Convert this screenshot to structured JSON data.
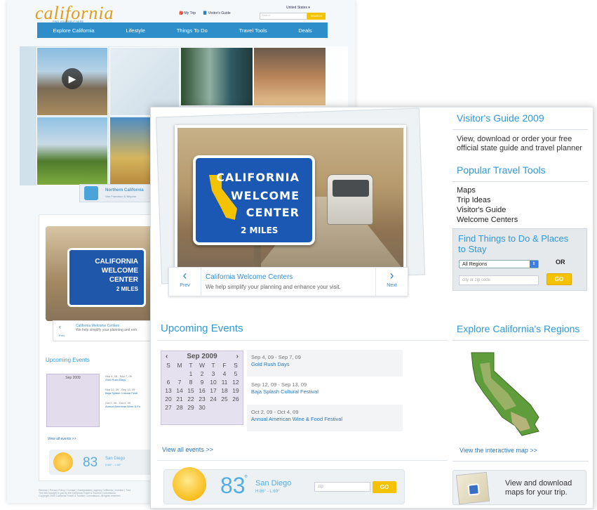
{
  "back_page": {
    "logo": "california",
    "tagline": "FIND YOURSELF HERE",
    "utility": {
      "my_trip": "My Trip",
      "visitors_guide": "Visitor's Guide",
      "country": "United States",
      "search_placeholder": "Search",
      "search_button": "SEARCH"
    },
    "nav": [
      "Explore California",
      "Lifestyle",
      "Things To Do",
      "Travel Tools",
      "Deals"
    ],
    "region_banner": {
      "title": "Northern California",
      "sub": "San Francisco & Beyond"
    },
    "feature": {
      "sign_lines": [
        "CALIFORNIA",
        "WELCOME",
        "CENTER",
        "2 MILES"
      ],
      "caption_title": "California Welcome Centers",
      "caption_sub": "We help simplify your planning and enh",
      "prev": "Prev"
    },
    "upcoming": "Upcoming Events",
    "calendar_title": "Sep 2009",
    "events": [
      {
        "date": "Sep 4, 09 - Sep 7, 09",
        "name": "Gold Rush Days"
      },
      {
        "date": "Sep 12, 09 - Sep 13, 09",
        "name": "Baja Splash Cultural Festi"
      },
      {
        "date": "Oct 2, 09 - Oct 4, 09",
        "name": "Annual American Wine & Fo"
      }
    ],
    "view_all": "View all events >>",
    "weather": {
      "temp": "83",
      "city": "San Diego",
      "hilo": "H:86° - L:69°"
    },
    "footer": "Sitemap | Privacy Policy | Contact | Sweepstakes | Agency Celifornia | Investor | Trad\nThis site brought to you by the California Travel & Tourism Commission.\nCopyright 2009 California Travel & Tourism Commission. All rights reserved."
  },
  "feature": {
    "sign_lines": [
      "CALIFORNIA",
      "WELCOME",
      "CENTER",
      "2 MILES"
    ],
    "caption_title": "California Welcome Centers",
    "caption_sub": "We help simplify your planning and enhance your visit.",
    "prev": "Prev",
    "next": "Next"
  },
  "guide": {
    "title": "Visitor's Guide 2009",
    "text": "View, download or order your free official state guide and travel planner"
  },
  "tools": {
    "title": "Popular Travel Tools",
    "links": [
      "Maps",
      "Trip Ideas",
      "Visitor's Guide",
      "Welcome Centers"
    ]
  },
  "find": {
    "title": "Find Things to Do & Places to Stay",
    "region": "All Regions",
    "or": "OR",
    "city_placeholder": "city or zip code",
    "go": "GO"
  },
  "events": {
    "title": "Upcoming Events",
    "calendar": {
      "month": "Sep 2009",
      "weekdays": [
        "S",
        "M",
        "T",
        "W",
        "T",
        "F",
        "S"
      ],
      "days": [
        "",
        "",
        "1",
        "2",
        "3",
        "4",
        "5",
        "6",
        "7",
        "8",
        "9",
        "10",
        "11",
        "12",
        "13",
        "14",
        "15",
        "16",
        "17",
        "18",
        "19",
        "20",
        "21",
        "22",
        "23",
        "24",
        "25",
        "26",
        "27",
        "28",
        "29",
        "30",
        "",
        "",
        ""
      ]
    },
    "list": [
      {
        "date": "Sep 4, 09 - Sep 7, 09",
        "name": "Gold Rush Days"
      },
      {
        "date": "Sep 12, 09 - Sep 13, 09",
        "name": "Baja Splash Cultural Festival"
      },
      {
        "date": "Oct 2, 09 - Oct 4, 09",
        "name": "Annual American Wine & Food Festival"
      }
    ],
    "view_all": "View all events >>"
  },
  "weather": {
    "temp": "83",
    "degree": "°",
    "city": "San Diego",
    "hilo": "H:86° - L:69°",
    "zip_placeholder": "zip",
    "go": "GO"
  },
  "regions": {
    "title": "Explore California's Regions",
    "map_link": "View the interactive map >>",
    "maps_promo": "View and download maps for your trip."
  },
  "colors": {
    "brand_blue": "#2d8ec9",
    "accent_yellow": "#f5c200",
    "sign_blue": "#1a58b4"
  }
}
